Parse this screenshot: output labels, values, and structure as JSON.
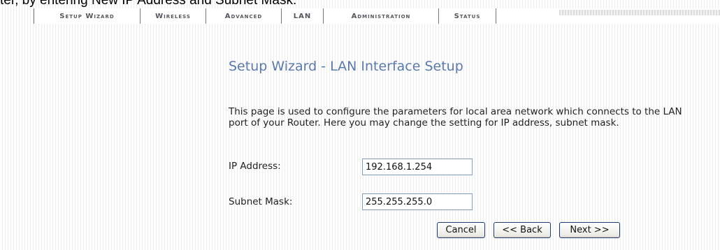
{
  "doc_caption": "ter, by entering New IP Address and Subnet Mask.",
  "nav": {
    "tabs": [
      {
        "label": "Setup Wizard"
      },
      {
        "label": "Wireless"
      },
      {
        "label": "Advanced"
      },
      {
        "label": "LAN"
      },
      {
        "label": "Administration"
      },
      {
        "label": "Status"
      }
    ]
  },
  "page": {
    "title": "Setup Wizard - LAN Interface Setup",
    "description": "This page is used to configure the parameters for local area network which connects to the LAN port of your Router. Here you may change the setting for IP address, subnet mask."
  },
  "form": {
    "ip_label": "IP Address:",
    "ip_value": "192.168.1.254",
    "mask_label": "Subnet Mask:",
    "mask_value": "255.255.255.0"
  },
  "buttons": {
    "cancel": "Cancel",
    "back": "<< Back",
    "next": "Next >>"
  },
  "colors": {
    "title": "#5b7aa8",
    "nav_text": "#56565e",
    "input_border": "#7f9db9",
    "button_border": "#1c3a6e"
  }
}
